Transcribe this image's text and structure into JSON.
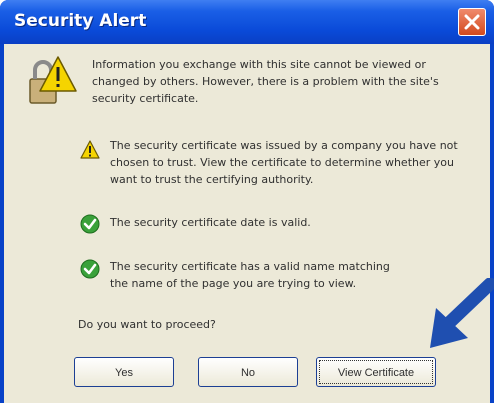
{
  "window": {
    "title": "Security Alert",
    "close_icon": "close-icon"
  },
  "intro_text": "Information you exchange with this site cannot be viewed or changed by others. However, there is a problem with the site's security certificate.",
  "items": [
    {
      "icon": "warning-icon",
      "text": "The security certificate was issued by a company you have not chosen to trust. View the certificate to determine whether you want to trust the certifying authority."
    },
    {
      "icon": "check-icon",
      "text": "The security certificate date is valid."
    },
    {
      "icon": "check-icon",
      "text": "The security certificate has a valid name matching the name of the page you are trying to view."
    }
  ],
  "question": "Do you want to proceed?",
  "buttons": {
    "yes": "Yes",
    "no": "No",
    "view": "View Certificate"
  },
  "colors": {
    "title_bar": "#0a4ad8",
    "dialog_bg": "#ece9d8",
    "pointer_arrow": "#1f4fb0",
    "check_green": "#3aa13a",
    "warning_yellow": "#f5d400"
  }
}
